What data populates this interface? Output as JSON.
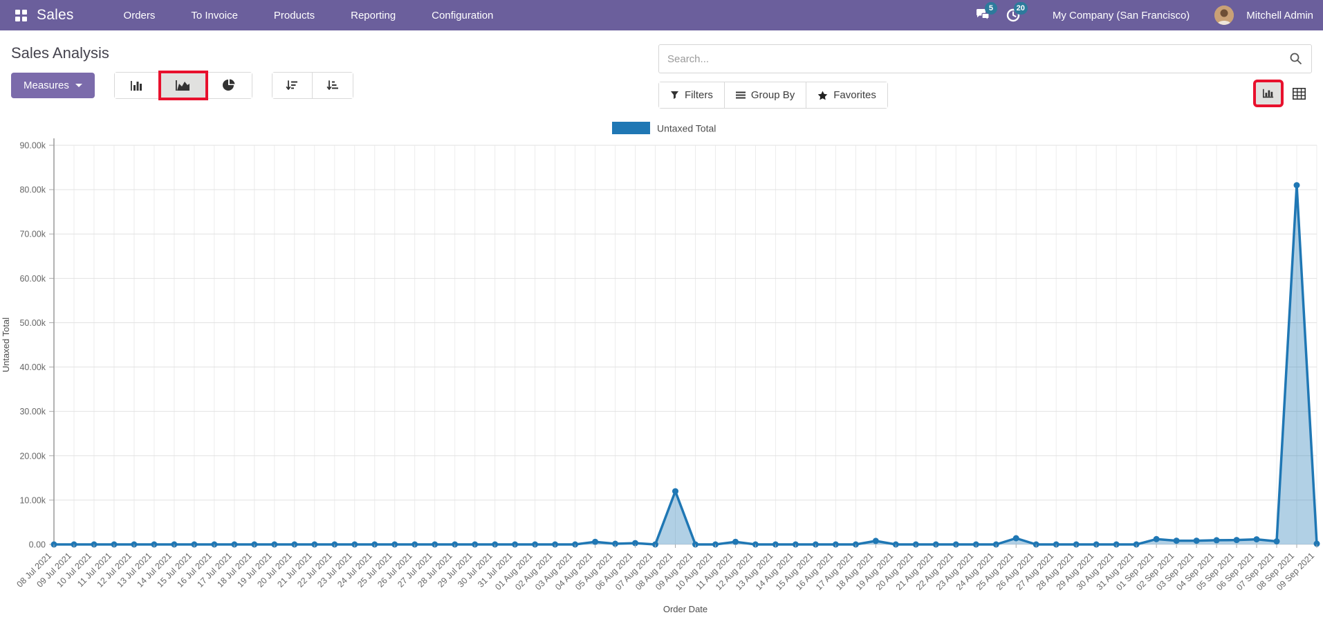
{
  "nav": {
    "app_name": "Sales",
    "items": [
      {
        "label": "Orders"
      },
      {
        "label": "To Invoice"
      },
      {
        "label": "Products"
      },
      {
        "label": "Reporting"
      },
      {
        "label": "Configuration"
      }
    ],
    "messages_badge": "5",
    "activities_badge": "20",
    "company": "My Company (San Francisco)",
    "user": "Mitchell Admin"
  },
  "control_panel": {
    "title": "Sales Analysis",
    "measures_label": "Measures",
    "search_placeholder": "Search...",
    "filters_label": "Filters",
    "group_by_label": "Group By",
    "favorites_label": "Favorites"
  },
  "chart_data": {
    "type": "area",
    "title": "",
    "legend": [
      "Untaxed Total"
    ],
    "legend_position": "top-center",
    "xlabel": "Order Date",
    "ylabel": "Untaxed Total",
    "ylim": [
      0,
      90000
    ],
    "grid": true,
    "y_ticks": [
      "0.00",
      "10.00k",
      "20.00k",
      "30.00k",
      "40.00k",
      "50.00k",
      "60.00k",
      "70.00k",
      "80.00k",
      "90.00k"
    ],
    "line_color": "#1f77b4",
    "fill_color": "rgba(31,119,180,0.35)",
    "categories": [
      "08 Jul 2021",
      "09 Jul 2021",
      "10 Jul 2021",
      "11 Jul 2021",
      "12 Jul 2021",
      "13 Jul 2021",
      "14 Jul 2021",
      "15 Jul 2021",
      "16 Jul 2021",
      "17 Jul 2021",
      "18 Jul 2021",
      "19 Jul 2021",
      "20 Jul 2021",
      "21 Jul 2021",
      "22 Jul 2021",
      "23 Jul 2021",
      "24 Jul 2021",
      "25 Jul 2021",
      "26 Jul 2021",
      "27 Jul 2021",
      "28 Jul 2021",
      "29 Jul 2021",
      "30 Jul 2021",
      "31 Jul 2021",
      "01 Aug 2021",
      "02 Aug 2021",
      "03 Aug 2021",
      "04 Aug 2021",
      "05 Aug 2021",
      "06 Aug 2021",
      "07 Aug 2021",
      "08 Aug 2021",
      "09 Aug 2021",
      "10 Aug 2021",
      "11 Aug 2021",
      "12 Aug 2021",
      "13 Aug 2021",
      "14 Aug 2021",
      "15 Aug 2021",
      "16 Aug 2021",
      "17 Aug 2021",
      "18 Aug 2021",
      "19 Aug 2021",
      "20 Aug 2021",
      "21 Aug 2021",
      "22 Aug 2021",
      "23 Aug 2021",
      "24 Aug 2021",
      "25 Aug 2021",
      "26 Aug 2021",
      "27 Aug 2021",
      "28 Aug 2021",
      "29 Aug 2021",
      "30 Aug 2021",
      "31 Aug 2021",
      "01 Sep 2021",
      "02 Sep 2021",
      "03 Sep 2021",
      "04 Sep 2021",
      "05 Sep 2021",
      "06 Sep 2021",
      "07 Sep 2021",
      "08 Sep 2021",
      "09 Sep 2021"
    ],
    "values": [
      0,
      0,
      0,
      0,
      0,
      0,
      0,
      0,
      0,
      0,
      0,
      0,
      0,
      0,
      0,
      0,
      0,
      0,
      0,
      0,
      0,
      0,
      0,
      0,
      0,
      0,
      0,
      600,
      150,
      300,
      0,
      12000,
      0,
      0,
      600,
      0,
      0,
      0,
      0,
      0,
      0,
      800,
      0,
      0,
      0,
      0,
      0,
      0,
      1400,
      0,
      0,
      0,
      0,
      0,
      0,
      1200,
      850,
      850,
      950,
      1000,
      1150,
      700,
      81000,
      150
    ]
  },
  "colors": {
    "header_bg": "#6b5f9c",
    "accent_purple": "#7b6bab",
    "badge_teal": "#2d7a9c",
    "highlight_red": "#e8112d",
    "series_blue": "#1f77b4"
  }
}
